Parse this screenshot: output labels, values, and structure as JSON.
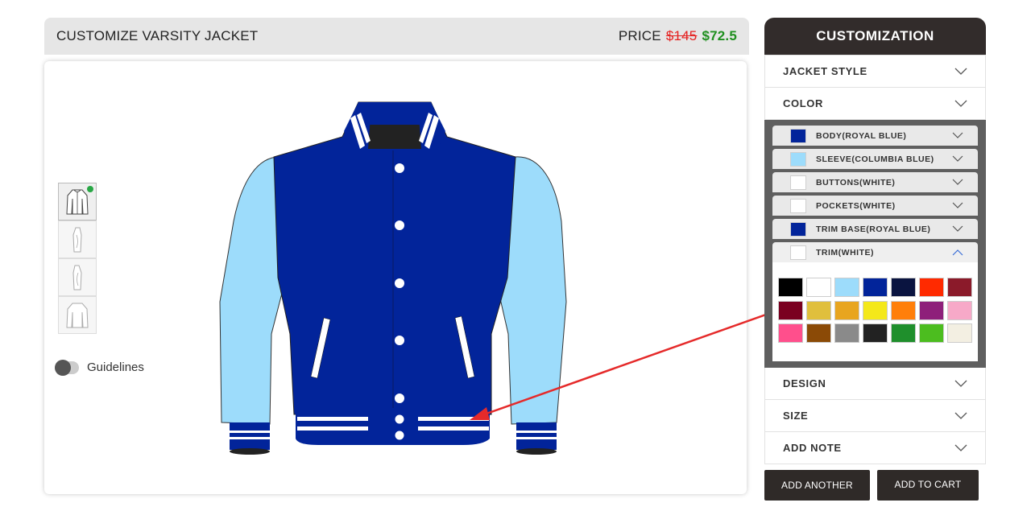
{
  "header": {
    "title": "CUSTOMIZE VARSITY JACKET",
    "price_label": "PRICE",
    "price_old": "$145",
    "price_new": "$72.5"
  },
  "views": [
    {
      "name": "front-view",
      "active": true
    },
    {
      "name": "left-side-view",
      "active": false
    },
    {
      "name": "right-side-view",
      "active": false
    },
    {
      "name": "back-view",
      "active": false
    }
  ],
  "guidelines": {
    "label": "Guidelines",
    "enabled": false
  },
  "panel": {
    "title": "CUSTOMIZATION",
    "sections_top": [
      "JACKET STYLE",
      "COLOR"
    ],
    "color_options": [
      {
        "label": "BODY(ROYAL BLUE)",
        "color": "#02249a",
        "open": false
      },
      {
        "label": "SLEEVE(COLUMBIA BLUE)",
        "color": "#9ddcfb",
        "open": false
      },
      {
        "label": "BUTTONS(WHITE)",
        "color": "#ffffff",
        "open": false
      },
      {
        "label": "POCKETS(WHITE)",
        "color": "#ffffff",
        "open": false
      },
      {
        "label": "TRIM BASE(ROYAL BLUE)",
        "color": "#02249a",
        "open": false
      },
      {
        "label": "TRIM(WHITE)",
        "color": "#ffffff",
        "open": true
      }
    ],
    "palette": [
      "#000000",
      "#ffffff",
      "#9ddcfb",
      "#02249a",
      "#0a1440",
      "#ff2a00",
      "#8b1a2a",
      "#7a0020",
      "#e0bf3c",
      "#e8a51f",
      "#f4e81a",
      "#ff7f0a",
      "#8e1f7a",
      "#f7a9c8",
      "#ff4f8c",
      "#8b4a06",
      "#8a8a8a",
      "#222222",
      "#1f8f2c",
      "#4cbd1f",
      "#f3efe2"
    ],
    "sections_bottom": [
      "DESIGN",
      "SIZE",
      "ADD NOTE"
    ]
  },
  "buttons": {
    "add_another": "ADD ANOTHER",
    "add_to_cart": "ADD TO CART"
  },
  "colors": {
    "body": "#02249a",
    "sleeve": "#9ddcfb",
    "trim": "#ffffff",
    "collar_inner": "#222222",
    "arrow": "#e52a2a"
  }
}
